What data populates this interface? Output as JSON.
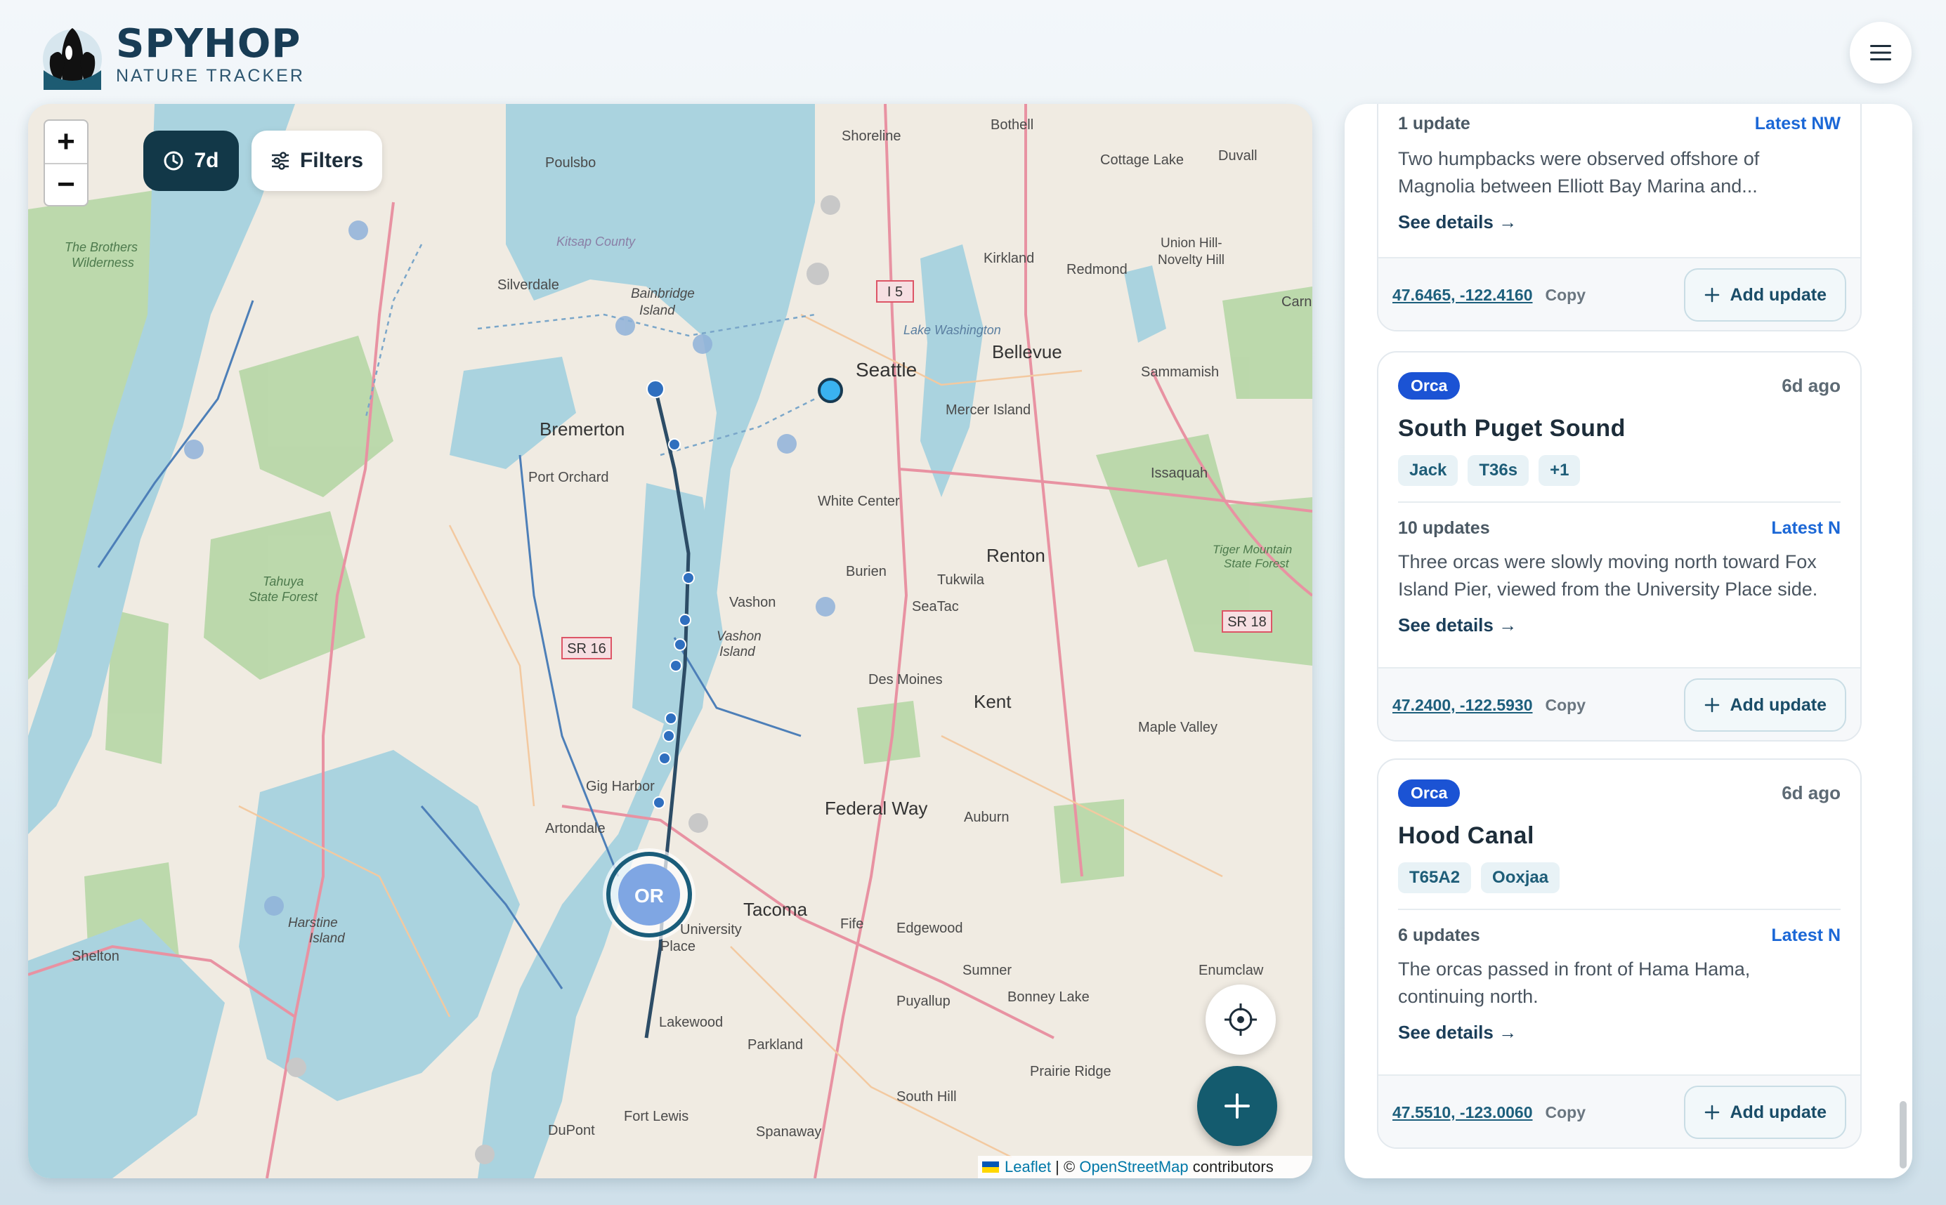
{
  "brand": {
    "name": "SPYHOP",
    "subtitle": "NATURE TRACKER"
  },
  "header": {
    "menu_icon": "hamburger-icon"
  },
  "map": {
    "zoom_in": "+",
    "zoom_out": "−",
    "time_filter_label": "7d",
    "filters_label": "Filters",
    "attribution": {
      "leaflet": "Leaflet",
      "separator": " | © ",
      "osm": "OpenStreetMap",
      "suffix": " contributors"
    },
    "active_marker_label": "OR",
    "place_labels": [
      "Shoreline",
      "Bothell",
      "Duvall",
      "Poulsbo",
      "Cottage Lake",
      "Kitsap County",
      "Silverdale",
      "Bainbridge",
      "Island",
      "Kirkland",
      "Redmond",
      "Union Hill-",
      "Novelty Hill",
      "Carn",
      "The Brothers",
      "Wilderness",
      "Lake Washington",
      "Seattle",
      "Bellevue",
      "Sammamish",
      "Bremerton",
      "Mercer Island",
      "Port Orchard",
      "Issaquah",
      "White Center",
      "Renton",
      "Tiger Mountain",
      "State Forest",
      "Burien",
      "Tukwila",
      "Tahuya",
      "State Forest",
      "Vashon",
      "SeaTac",
      "Vashon",
      "Island",
      "Des Moines",
      "Kent",
      "Maple Valley",
      "Gig Harbor",
      "Federal Way",
      "Auburn",
      "Artondale",
      "Tacoma",
      "Fife",
      "Edgewood",
      "Harstine",
      "Island",
      "Shelton",
      "Sumner",
      "Puyallup",
      "Bonney Lake",
      "Enumclaw",
      "Lakewood",
      "Parkland",
      "Prairie Ridge",
      "South Hill",
      "Fort Lewis",
      "DuPont",
      "Spanaway",
      "University",
      "Place"
    ],
    "road_shields": [
      "I 5",
      "SR 16",
      "SR 18"
    ]
  },
  "sightings": [
    {
      "updates": "1 update",
      "latest": "Latest NW",
      "description": "Two humpbacks were observed offshore of Magnolia between Elliott Bay Marina and...",
      "see_details": "See details →",
      "coords": "47.6465, -122.4160",
      "copy": "Copy",
      "add_update": "Add update"
    },
    {
      "species": "Orca",
      "ago": "6d ago",
      "title": "South Puget Sound",
      "tags": [
        "Jack",
        "T36s",
        "+1"
      ],
      "updates": "10 updates",
      "latest": "Latest N",
      "description": "Three orcas were slowly moving north toward Fox Island Pier, viewed from the University Place side.",
      "see_details": "See details →",
      "coords": "47.2400, -122.5930",
      "copy": "Copy",
      "add_update": "Add update"
    },
    {
      "species": "Orca",
      "ago": "6d ago",
      "title": "Hood Canal",
      "tags": [
        "T65A2",
        "Ooxjaa"
      ],
      "updates": "6 updates",
      "latest": "Latest N",
      "description": "The orcas passed in front of Hama Hama, continuing north.",
      "see_details": "See details →",
      "coords": "47.5510, -123.0060",
      "copy": "Copy",
      "add_update": "Add update"
    }
  ],
  "colors": {
    "brand": "#183c55",
    "accent": "#1b53d4",
    "fab": "#145b6e",
    "water": "#aad3df",
    "forest": "#add19e"
  }
}
